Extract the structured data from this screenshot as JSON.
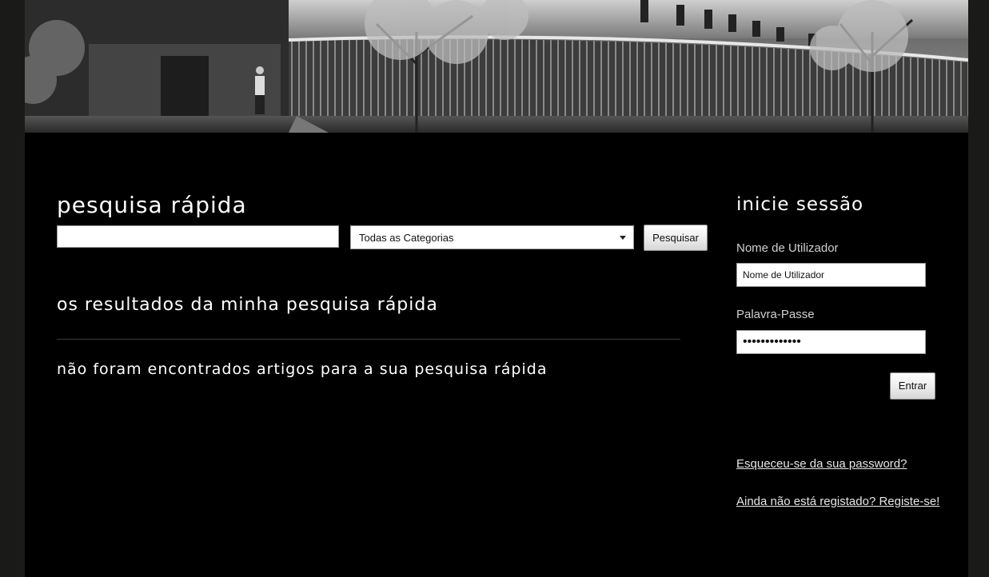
{
  "search": {
    "title": "pesquisa rápida",
    "input_value": "",
    "category_selected": "Todas as Categorias",
    "button_label": "Pesquisar"
  },
  "results": {
    "title": "os resultados da minha pesquisa rápida",
    "empty_message": "não foram encontrados artigos para a sua pesquisa rápida"
  },
  "login": {
    "title": "inicie sessão",
    "username_label": "Nome de Utilizador",
    "username_value": "Nome de Utilizador",
    "password_label": "Palavra-Passe",
    "password_value": "•••••••••••••",
    "submit_label": "Entrar",
    "forgot_link": "Esqueceu-se da sua password?",
    "register_link": "Ainda não está registado? Registe-se!"
  },
  "colors": {
    "page_background": "#000000",
    "outer_background": "#1a1a18",
    "text": "#ffffff",
    "label_text": "#d0d0d0"
  }
}
